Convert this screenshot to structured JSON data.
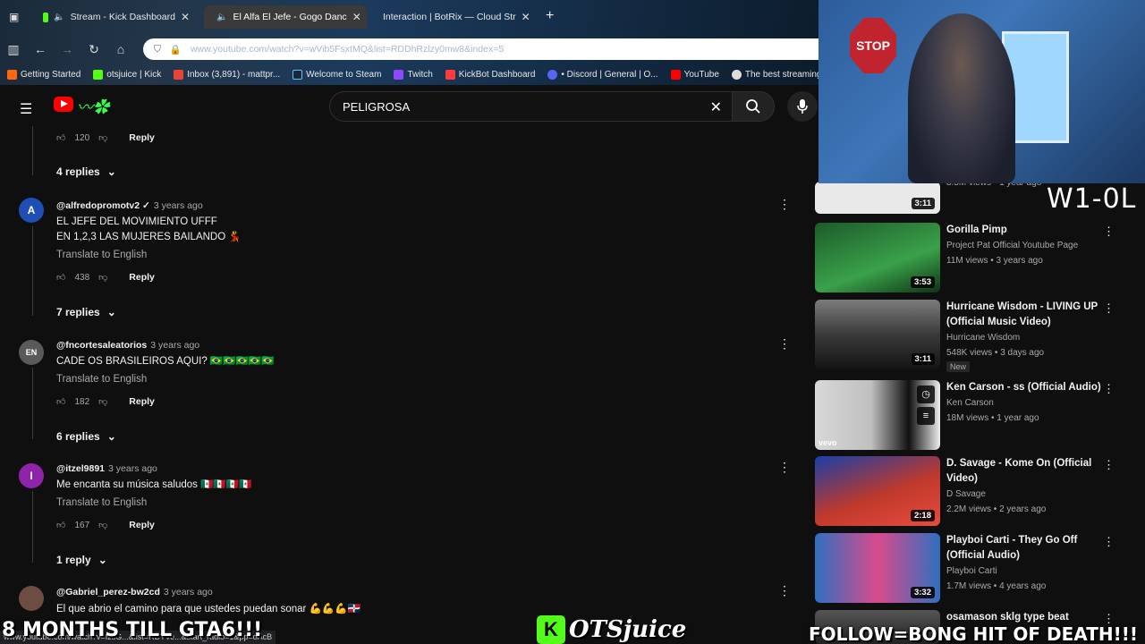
{
  "browser": {
    "tabs": [
      {
        "label": "Stream - Kick Dashboard",
        "color": "#53fc18"
      },
      {
        "label": "El Alfa El Jefe - Gogo Danc",
        "color": "#ff0000"
      },
      {
        "label": "Interaction | BotRix — Cloud Str",
        "color": "#cccccc"
      }
    ],
    "url": "www.youtube.com/watch?v=wVib5FsxtMQ&list=RDDhRzlzy0mw8&index=5",
    "bookmarks": [
      "Getting Started",
      "otsjuice | Kick",
      "Inbox (3,891) - mattpr...",
      "Welcome to Steam",
      "Twitch",
      "KickBot Dashboard",
      "• Discord | General | O...",
      "YouTube",
      "The best streaming bo..."
    ]
  },
  "search": {
    "query": "PELIGROSA"
  },
  "comments": [
    {
      "likes": "120",
      "reply_label": "Reply",
      "replies": "4 replies"
    },
    {
      "author": "@alfredopromotv2 ✓",
      "date": "3 years ago",
      "lines": [
        "EL JEFE DEL MOVIMIENTO UFFF",
        "EN 1,2,3 LAS MUJERES BAILANDO 💃"
      ],
      "translate": "Translate to English",
      "likes": "438",
      "reply_label": "Reply",
      "replies": "7 replies",
      "avatar_color": "#1f4fb5"
    },
    {
      "author": "@fncortesaleatorios",
      "date": "3 years ago",
      "lines": [
        "CADE OS BRASILEIROS AQUI? 🇧🇷🇧🇷🇧🇷🇧🇷🇧🇷"
      ],
      "translate": "Translate to English",
      "likes": "182",
      "reply_label": "Reply",
      "replies": "6 replies",
      "avatar_color": "#5a5a5a"
    },
    {
      "author": "@itzel9891",
      "date": "3 years ago",
      "lines": [
        "Me encanta su música saludos 🇲🇽🇲🇽🇲🇽🇲🇽"
      ],
      "translate": "Translate to English",
      "likes": "167",
      "reply_label": "Reply",
      "replies": "1 reply",
      "avatar_initial": "I",
      "avatar_color": "#8e24aa"
    },
    {
      "author": "@Gabriel_perez-bw2cd",
      "date": "3 years ago",
      "lines": [
        "El que abrio el camino para que ustedes puedan sonar 💪💪💪🇩🇴"
      ],
      "avatar_color": "#6d4c41"
    }
  ],
  "sidebar": [
    {
      "title": "",
      "channel": "",
      "meta": "8.5M views • 1 year ago",
      "duration": "3:11",
      "thumb_color": "#e9e9e9"
    },
    {
      "title": "Gorilla Pimp",
      "channel": "Project Pat Official Youtube Page",
      "meta": "11M views • 3 years ago",
      "duration": "3:53",
      "thumb_color": "#2b7a3a"
    },
    {
      "title": "Hurricane Wisdom - LIVING UP (Official Music Video)",
      "channel": "Hurricane Wisdom",
      "meta": "548K views • 3 days ago",
      "duration": "3:11",
      "badge": "New",
      "thumb_color": "#5b5b5b"
    },
    {
      "title": "Ken Carson - ss (Official Audio)",
      "channel": "Ken Carson",
      "meta": "18M views • 1 year ago",
      "duration": "",
      "thumb_color": "#cfcfcf",
      "vevo": "vevo"
    },
    {
      "title": "D. Savage - Kome On (Official Video)",
      "channel": "D Savage",
      "meta": "2.2M views • 2 years ago",
      "duration": "2:18",
      "thumb_color": "#c0392b"
    },
    {
      "title": "Playboi Carti - They Go Off (Official Audio)",
      "channel": "Playboi Carti",
      "meta": "1.7M views • 4 years ago",
      "duration": "3:32",
      "thumb_color": "#2f6fc0"
    },
    {
      "title": "osamason sklg type beat",
      "channel": "",
      "meta": "",
      "duration": "",
      "thumb_color": "#3a3a3a"
    }
  ],
  "overlay": {
    "record": "W1-0L",
    "countdown": "8 MONTHS TILL GTA6!!!",
    "brand": "OTSjuice",
    "follow": "FOLLOW=BONG HIT OF DEATH!!!",
    "stop_sign": "STOP",
    "status_url": "www.youtube.com/watch?v=fzsG...&list=RDTVe...&start_radio=1&pp=oAcB"
  }
}
